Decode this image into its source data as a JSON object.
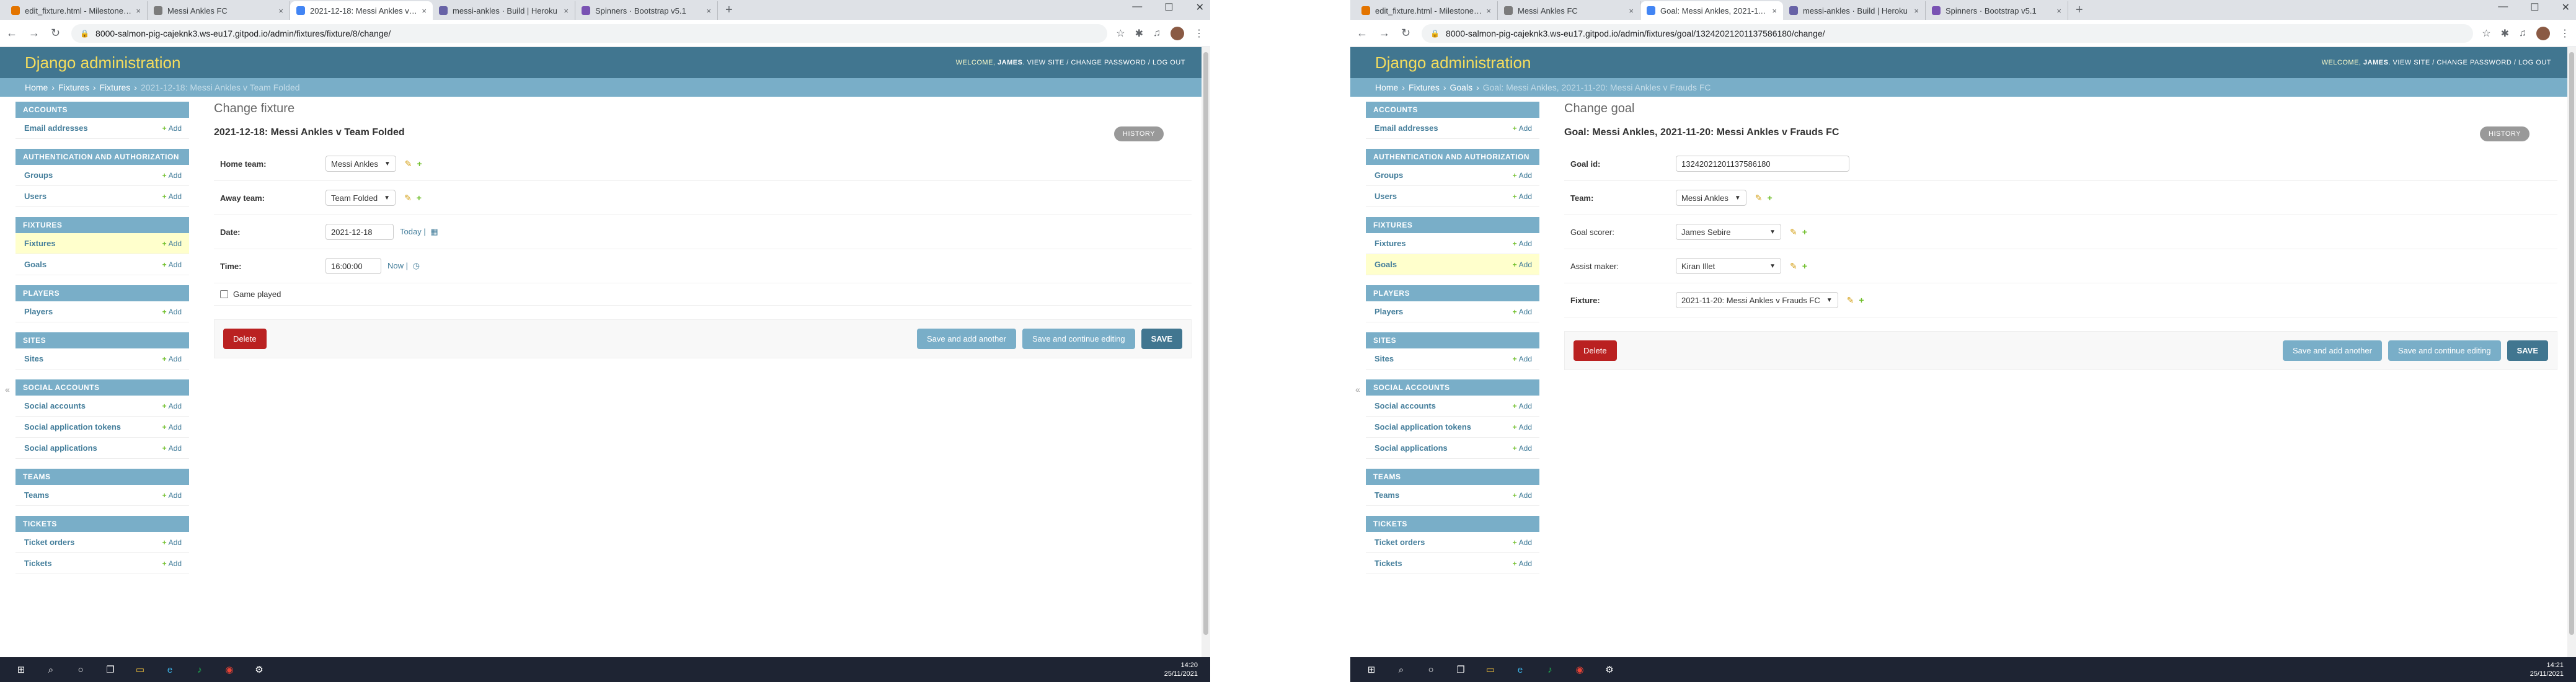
{
  "left": {
    "tabs": [
      {
        "title": "edit_fixture.html - Milestone-Pr...",
        "color": "#e37400"
      },
      {
        "title": "Messi Ankles FC",
        "color": "#7b7b7b"
      },
      {
        "title": "2021-12-18: Messi Ankles v Tea...",
        "color": "#4285f4"
      },
      {
        "title": "messi-ankles · Build | Heroku",
        "color": "#6762a6"
      },
      {
        "title": "Spinners · Bootstrap v5.1",
        "color": "#7952b3"
      }
    ],
    "url": "8000-salmon-pig-cajeknk3.ws-eu17.gitpod.io/admin/fixtures/fixture/8/change/",
    "branding": "Django administration",
    "usertools": {
      "welcome": "WELCOME,",
      "user": "JAMES",
      "links": ". VIEW SITE / CHANGE PASSWORD / LOG OUT"
    },
    "breadcrumbs": [
      "Home",
      "Fixtures",
      "Fixtures",
      "2021-12-18: Messi Ankles v Team Folded"
    ],
    "sidebar": [
      {
        "caption": "Accounts",
        "rows": [
          {
            "name": "Email addresses",
            "add": "Add",
            "current": false
          }
        ]
      },
      {
        "caption": "Authentication and Authorization",
        "rows": [
          {
            "name": "Groups",
            "add": "Add",
            "current": false
          },
          {
            "name": "Users",
            "add": "Add",
            "current": false
          }
        ]
      },
      {
        "caption": "Fixtures",
        "rows": [
          {
            "name": "Fixtures",
            "add": "Add",
            "current": true
          },
          {
            "name": "Goals",
            "add": "Add",
            "current": false
          }
        ]
      },
      {
        "caption": "Players",
        "rows": [
          {
            "name": "Players",
            "add": "Add",
            "current": false
          }
        ]
      },
      {
        "caption": "Sites",
        "rows": [
          {
            "name": "Sites",
            "add": "Add",
            "current": false
          }
        ]
      },
      {
        "caption": "Social Accounts",
        "rows": [
          {
            "name": "Social accounts",
            "add": "Add",
            "current": false
          },
          {
            "name": "Social application tokens",
            "add": "Add",
            "current": false
          },
          {
            "name": "Social applications",
            "add": "Add",
            "current": false
          }
        ]
      },
      {
        "caption": "Teams",
        "rows": [
          {
            "name": "Teams",
            "add": "Add",
            "current": false
          }
        ]
      },
      {
        "caption": "Tickets",
        "rows": [
          {
            "name": "Ticket orders",
            "add": "Add",
            "current": false
          },
          {
            "name": "Tickets",
            "add": "Add",
            "current": false
          }
        ]
      }
    ],
    "page_title": "Change fixture",
    "object_title": "2021-12-18: Messi Ankles v Team Folded",
    "history": "HISTORY",
    "fields": {
      "home_team": {
        "label": "Home team:",
        "value": "Messi Ankles"
      },
      "away_team": {
        "label": "Away team:",
        "value": "Team Folded"
      },
      "date": {
        "label": "Date:",
        "value": "2021-12-18",
        "shortcut": "Today"
      },
      "time": {
        "label": "Time:",
        "value": "16:00:00",
        "shortcut": "Now"
      },
      "game_played": {
        "label": "Game played"
      }
    },
    "buttons": {
      "delete": "Delete",
      "save_add": "Save and add another",
      "save_continue": "Save and continue editing",
      "save": "SAVE"
    },
    "clock": {
      "time": "14:20",
      "date": "25/11/2021"
    }
  },
  "right": {
    "tabs": [
      {
        "title": "edit_fixture.html - Milestone-Pr...",
        "color": "#e37400"
      },
      {
        "title": "Messi Ankles FC",
        "color": "#7b7b7b"
      },
      {
        "title": "Goal: Messi Ankles, 2021-11-20:...",
        "color": "#4285f4"
      },
      {
        "title": "messi-ankles · Build | Heroku",
        "color": "#6762a6"
      },
      {
        "title": "Spinners · Bootstrap v5.1",
        "color": "#7952b3"
      }
    ],
    "url": "8000-salmon-pig-cajeknk3.ws-eu17.gitpod.io/admin/fixtures/goal/1324202120113758618​0/change/",
    "branding": "Django administration",
    "usertools": {
      "welcome": "WELCOME,",
      "user": "JAMES",
      "links": ". VIEW SITE / CHANGE PASSWORD / LOG OUT"
    },
    "breadcrumbs": [
      "Home",
      "Fixtures",
      "Goals",
      "Goal: Messi Ankles, 2021-11-20: Messi Ankles v Frauds FC"
    ],
    "sidebar": [
      {
        "caption": "Accounts",
        "rows": [
          {
            "name": "Email addresses",
            "add": "Add",
            "current": false
          }
        ]
      },
      {
        "caption": "Authentication and Authorization",
        "rows": [
          {
            "name": "Groups",
            "add": "Add",
            "current": false
          },
          {
            "name": "Users",
            "add": "Add",
            "current": false
          }
        ]
      },
      {
        "caption": "Fixtures",
        "rows": [
          {
            "name": "Fixtures",
            "add": "Add",
            "current": false
          },
          {
            "name": "Goals",
            "add": "Add",
            "current": true
          }
        ]
      },
      {
        "caption": "Players",
        "rows": [
          {
            "name": "Players",
            "add": "Add",
            "current": false
          }
        ]
      },
      {
        "caption": "Sites",
        "rows": [
          {
            "name": "Sites",
            "add": "Add",
            "current": false
          }
        ]
      },
      {
        "caption": "Social Accounts",
        "rows": [
          {
            "name": "Social accounts",
            "add": "Add",
            "current": false
          },
          {
            "name": "Social application tokens",
            "add": "Add",
            "current": false
          },
          {
            "name": "Social applications",
            "add": "Add",
            "current": false
          }
        ]
      },
      {
        "caption": "Teams",
        "rows": [
          {
            "name": "Teams",
            "add": "Add",
            "current": false
          }
        ]
      },
      {
        "caption": "Tickets",
        "rows": [
          {
            "name": "Ticket orders",
            "add": "Add",
            "current": false
          },
          {
            "name": "Tickets",
            "add": "Add",
            "current": false
          }
        ]
      }
    ],
    "page_title": "Change goal",
    "object_title": "Goal: Messi Ankles, 2021-11-20: Messi Ankles v Frauds FC",
    "history": "HISTORY",
    "fields": {
      "goal_id": {
        "label": "Goal id:",
        "value": "13242021201137586180"
      },
      "team": {
        "label": "Team:",
        "value": "Messi Ankles"
      },
      "goal_scorer": {
        "label": "Goal scorer:",
        "value": "James Sebire"
      },
      "assist_maker": {
        "label": "Assist maker:",
        "value": "Kiran Illet"
      },
      "fixture": {
        "label": "Fixture:",
        "value": "2021-11-20: Messi Ankles v Frauds FC"
      }
    },
    "buttons": {
      "delete": "Delete",
      "save_add": "Save and add another",
      "save_continue": "Save and continue editing",
      "save": "SAVE"
    },
    "clock": {
      "time": "14:21",
      "date": "25/11/2021"
    }
  },
  "colors": {
    "header": "#417690",
    "breadcrumbs": "#79aec8",
    "branding": "#f5dd5d",
    "delete": "#ba2121",
    "add": "#70bf2b"
  },
  "taskbar_icons": [
    "windows-icon",
    "search-icon",
    "cortana-icon",
    "task-view-icon",
    "file-explorer-icon",
    "edge-icon",
    "spotify-icon",
    "chrome-icon",
    "settings-icon"
  ]
}
